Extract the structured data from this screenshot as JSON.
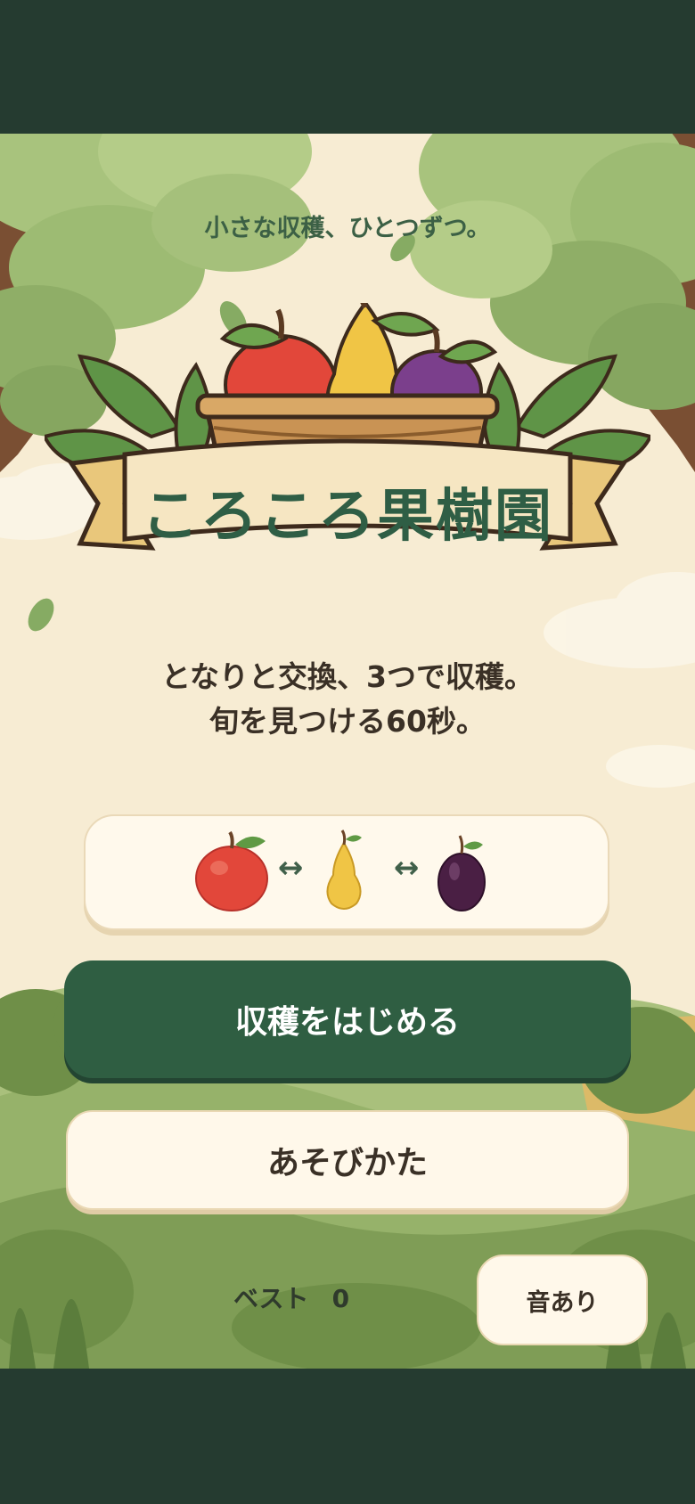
{
  "tagline": "小さな収穫、ひとつずつ。",
  "title": "ころころ果樹園",
  "description": {
    "line1": "となりと交換、3つで収穫。",
    "line2": "旬を見つける60秒。"
  },
  "swap_demo": {
    "fruits": [
      "apple-icon",
      "pear-icon",
      "plum-icon"
    ],
    "arrow1": "↔",
    "arrow2": "↔"
  },
  "buttons": {
    "start": "収穫をはじめる",
    "howto": "あそびかた",
    "sound": "音あり"
  },
  "best": {
    "label": "ベスト",
    "value": "0"
  },
  "colors": {
    "frame": "#253b30",
    "background": "#f7ecd3",
    "primary_button": "#2f5e42",
    "title_text": "#2f5e45"
  }
}
